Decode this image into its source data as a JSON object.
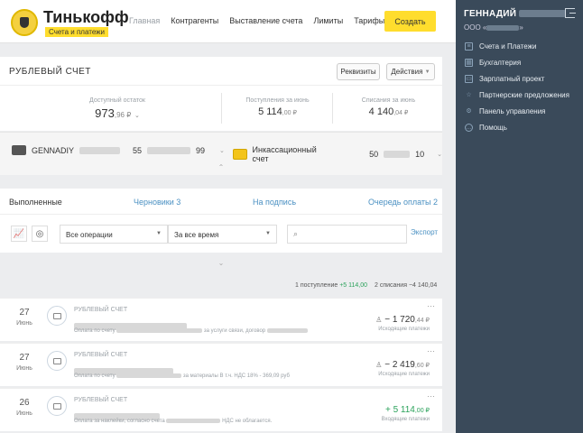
{
  "brand": {
    "name": "Тинькофф",
    "subtitle": "Счета и платежи"
  },
  "nav": [
    "Главная",
    "Контрагенты",
    "Выставление счета",
    "Лимиты",
    "Тарифы"
  ],
  "create_button": "Создать",
  "account": {
    "title": "РУБЛЕВЫЙ СЧЕТ",
    "requisites_button": "Реквизиты",
    "actions_button": "Действия",
    "available_label": "Доступный остаток",
    "available_value": "973",
    "available_cents": ",96 ₽",
    "income_label": "Поступления за июнь",
    "income_value": "5 114",
    "income_cents": ",00 ₽",
    "outcome_label": "Списания за июнь",
    "outcome_value": "4 140",
    "outcome_cents": ",04 ₽",
    "card_name": "GENNADIY",
    "card_number_start": "55",
    "card_number_end": "99",
    "collection_label": "Инкассационный счет",
    "collection_start": "50",
    "collection_end": "10"
  },
  "tabs": [
    "Выполненные",
    "Черновики 3",
    "На подпись",
    "Очередь оплаты 2"
  ],
  "filters": {
    "operations": "Все операции",
    "period": "За все время",
    "export": "Экспорт"
  },
  "summary": {
    "income": "1 поступление",
    "income_amount": "+5 114,00",
    "outcome": "2 списания",
    "outcome_amount": "−4 140,04"
  },
  "transactions": [
    {
      "day": "27",
      "month": "Июнь",
      "account": "РУБЛЕВЫЙ СЧЕТ",
      "desc_start": "Оплата по счету",
      "desc_end": "за услуги связи, договор",
      "amount": "− 1 720",
      "cents": ",44 ₽",
      "kind": "Исходящие платежи",
      "incoming": false
    },
    {
      "day": "27",
      "month": "Июнь",
      "account": "РУБЛЕВЫЙ СЧЕТ",
      "desc_start": "Оплата по счету",
      "desc_end": "за материалы В т.ч. НДС 18% - 369,09 руб",
      "amount": "− 2 419",
      "cents": ",60 ₽",
      "kind": "Исходящие платежи",
      "incoming": false
    },
    {
      "day": "26",
      "month": "Июнь",
      "account": "РУБЛЕВЫЙ СЧЕТ",
      "desc_start": "Оплата за наклейки, согласно счета",
      "desc_end": "НДС не облагается.",
      "amount": "+ 5 114",
      "cents": ",00 ₽",
      "kind": "Входящие платежи",
      "incoming": true
    }
  ],
  "sidebar": {
    "user": "ГЕННАДИЙ",
    "org": "ООО «",
    "menu": [
      {
        "label": "Счета и Платежи",
        "icon": "document-icon"
      },
      {
        "label": "Бухгалтерия",
        "icon": "calendar-icon"
      },
      {
        "label": "Зарплатный проект",
        "icon": "wallet-icon"
      },
      {
        "label": "Партнерские предложения",
        "icon": "star-icon"
      },
      {
        "label": "Панель управления",
        "icon": "gear-icon"
      },
      {
        "label": "Помощь",
        "icon": "chat-icon"
      }
    ]
  },
  "colors": {
    "accent": "#ffdd2d",
    "link": "#4a90c2",
    "sidebar": "#3a4a5a",
    "income": "#2ba25b"
  }
}
